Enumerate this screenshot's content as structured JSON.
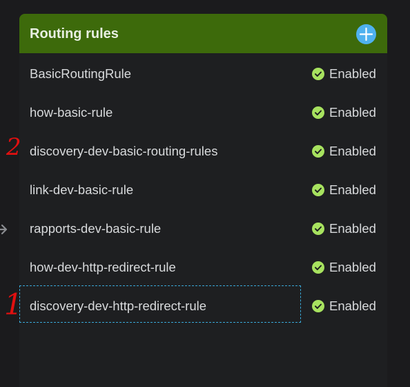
{
  "panel": {
    "title": "Routing rules",
    "add_icon": "plus-circle-icon",
    "accent_color": "#3d6a0b"
  },
  "rules": [
    {
      "name": "BasicRoutingRule",
      "status": "Enabled"
    },
    {
      "name": "how-basic-rule",
      "status": "Enabled"
    },
    {
      "name": "discovery-dev-basic-routing-rules",
      "status": "Enabled"
    },
    {
      "name": "link-dev-basic-rule",
      "status": "Enabled"
    },
    {
      "name": "rapports-dev-basic-rule",
      "status": "Enabled"
    },
    {
      "name": "how-dev-http-redirect-rule",
      "status": "Enabled"
    },
    {
      "name": "discovery-dev-http-redirect-rule",
      "status": "Enabled"
    }
  ],
  "status_icon": "check-circle-icon",
  "status_color": "#a7e25f",
  "annotations": {
    "mark_1": "1",
    "mark_2": "2"
  }
}
